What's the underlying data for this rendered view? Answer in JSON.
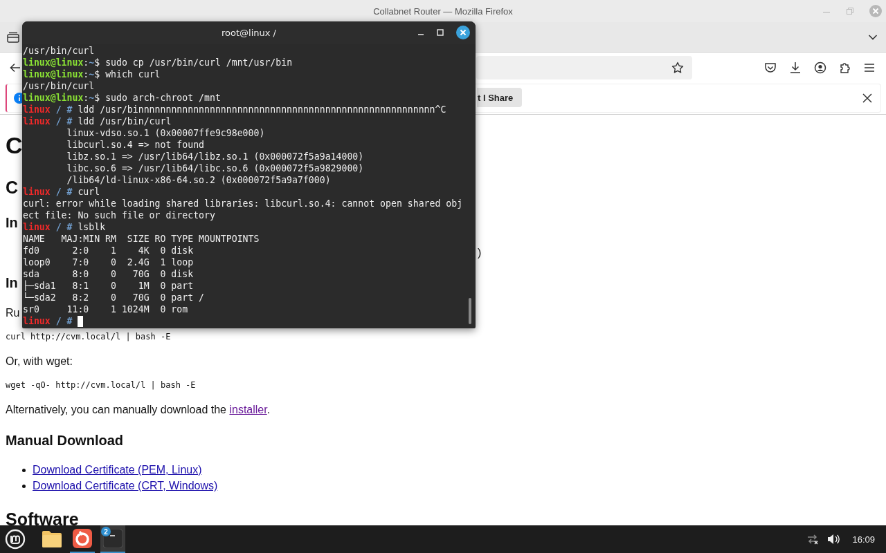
{
  "browser": {
    "window_title": "Collabnet Router — Mozilla Firefox",
    "notification": {
      "button": "t I Share"
    }
  },
  "page": {
    "blocks": [
      {
        "kind": "h1",
        "text": "C"
      },
      {
        "kind": "h2",
        "text": "C"
      },
      {
        "kind": "h3",
        "text": "In"
      },
      {
        "kind": "offset",
        "text": ")"
      },
      {
        "kind": "h3",
        "text": "In"
      },
      {
        "kind": "p",
        "text": "Ru"
      },
      {
        "kind": "code",
        "text": "curl http://cvm.local/l | bash -E"
      },
      {
        "kind": "p",
        "text": "Or, with wget:"
      },
      {
        "kind": "code",
        "text": "wget -qO- http://cvm.local/l | bash -E"
      },
      {
        "kind": "p",
        "text": "Alternatively, you can manually download the ",
        "link": "installer",
        "visited": true,
        "after": "."
      },
      {
        "kind": "h3",
        "text": "Manual Download"
      },
      {
        "kind": "li",
        "link": "Download Certificate (PEM, Linux)",
        "visited": false
      },
      {
        "kind": "li",
        "link": "Download Certificate (CRT, Windows)",
        "visited": false
      },
      {
        "kind": "h2",
        "text": "Software"
      }
    ]
  },
  "terminal": {
    "title": "root@linux /",
    "lines": [
      {
        "segments": [
          {
            "kind": "text",
            "text": "/usr/bin/curl"
          }
        ]
      },
      {
        "segments": [
          {
            "kind": "user",
            "text": "linux@linux"
          },
          {
            "kind": "text",
            "text": ":"
          },
          {
            "kind": "dir",
            "text": "~"
          },
          {
            "kind": "text",
            "text": "$ sudo cp /usr/bin/curl /mnt/usr/bin"
          }
        ]
      },
      {
        "segments": [
          {
            "kind": "user",
            "text": "linux@linux"
          },
          {
            "kind": "text",
            "text": ":"
          },
          {
            "kind": "dir",
            "text": "~"
          },
          {
            "kind": "text",
            "text": "$ which curl"
          }
        ]
      },
      {
        "segments": [
          {
            "kind": "text",
            "text": "/usr/bin/curl"
          }
        ]
      },
      {
        "segments": [
          {
            "kind": "user",
            "text": "linux@linux"
          },
          {
            "kind": "text",
            "text": ":"
          },
          {
            "kind": "dir",
            "text": "~"
          },
          {
            "kind": "text",
            "text": "$ sudo arch-chroot /mnt"
          }
        ]
      },
      {
        "segments": [
          {
            "kind": "host",
            "text": "linux"
          },
          {
            "kind": "dir",
            "text": " / # "
          },
          {
            "kind": "text",
            "text": "ldd /usr/binnnnnnnnnnnnnnnnnnnnnnnnnnnnnnnnnnnnnnnnnnnnnnnnnnnnnn^C"
          }
        ]
      },
      {
        "segments": [
          {
            "kind": "host",
            "text": "linux"
          },
          {
            "kind": "dir",
            "text": " / # "
          },
          {
            "kind": "text",
            "text": "ldd /usr/bin/curl"
          }
        ]
      },
      {
        "segments": [
          {
            "kind": "text",
            "text": "        linux-vdso.so.1 (0x00007ffe9c98e000)"
          }
        ]
      },
      {
        "segments": [
          {
            "kind": "text",
            "text": "        libcurl.so.4 => not found"
          }
        ]
      },
      {
        "segments": [
          {
            "kind": "text",
            "text": "        libz.so.1 => /usr/lib64/libz.so.1 (0x000072f5a9a14000)"
          }
        ]
      },
      {
        "segments": [
          {
            "kind": "text",
            "text": "        libc.so.6 => /usr/lib64/libc.so.6 (0x000072f5a9829000)"
          }
        ]
      },
      {
        "segments": [
          {
            "kind": "text",
            "text": "        /lib64/ld-linux-x86-64.so.2 (0x000072f5a9a7f000)"
          }
        ]
      },
      {
        "segments": [
          {
            "kind": "host",
            "text": "linux"
          },
          {
            "kind": "dir",
            "text": " / # "
          },
          {
            "kind": "text",
            "text": "curl"
          }
        ]
      },
      {
        "segments": [
          {
            "kind": "text",
            "text": "curl: error while loading shared libraries: libcurl.so.4: cannot open shared obj"
          }
        ]
      },
      {
        "segments": [
          {
            "kind": "text",
            "text": "ect file: No such file or directory"
          }
        ]
      },
      {
        "segments": [
          {
            "kind": "host",
            "text": "linux"
          },
          {
            "kind": "dir",
            "text": " / # "
          },
          {
            "kind": "text",
            "text": "lsblk"
          }
        ]
      },
      {
        "segments": [
          {
            "kind": "text",
            "text": "NAME   MAJ:MIN RM  SIZE RO TYPE MOUNTPOINTS"
          }
        ]
      },
      {
        "segments": [
          {
            "kind": "text",
            "text": "fd0      2:0    1    4K  0 disk"
          }
        ]
      },
      {
        "segments": [
          {
            "kind": "text",
            "text": "loop0    7:0    0  2.4G  1 loop"
          }
        ]
      },
      {
        "segments": [
          {
            "kind": "text",
            "text": "sda      8:0    0   70G  0 disk"
          }
        ]
      },
      {
        "segments": [
          {
            "kind": "text",
            "text": "├─sda1   8:1    0    1M  0 part"
          }
        ]
      },
      {
        "segments": [
          {
            "kind": "text",
            "text": "└─sda2   8:2    0   70G  0 part /"
          }
        ]
      },
      {
        "segments": [
          {
            "kind": "text",
            "text": "sr0     11:0    1 1024M  0 rom"
          }
        ]
      },
      {
        "segments": [
          {
            "kind": "host",
            "text": "linux"
          },
          {
            "kind": "dir",
            "text": " / # "
          }
        ],
        "cursor": true
      }
    ]
  },
  "taskbar": {
    "apps": [
      {
        "kind": "files",
        "running": false,
        "selected": false
      },
      {
        "kind": "browser",
        "running": true,
        "selected": false
      },
      {
        "kind": "terminal",
        "running": true,
        "selected": true,
        "badge": "2"
      }
    ],
    "clock": "16:09"
  }
}
